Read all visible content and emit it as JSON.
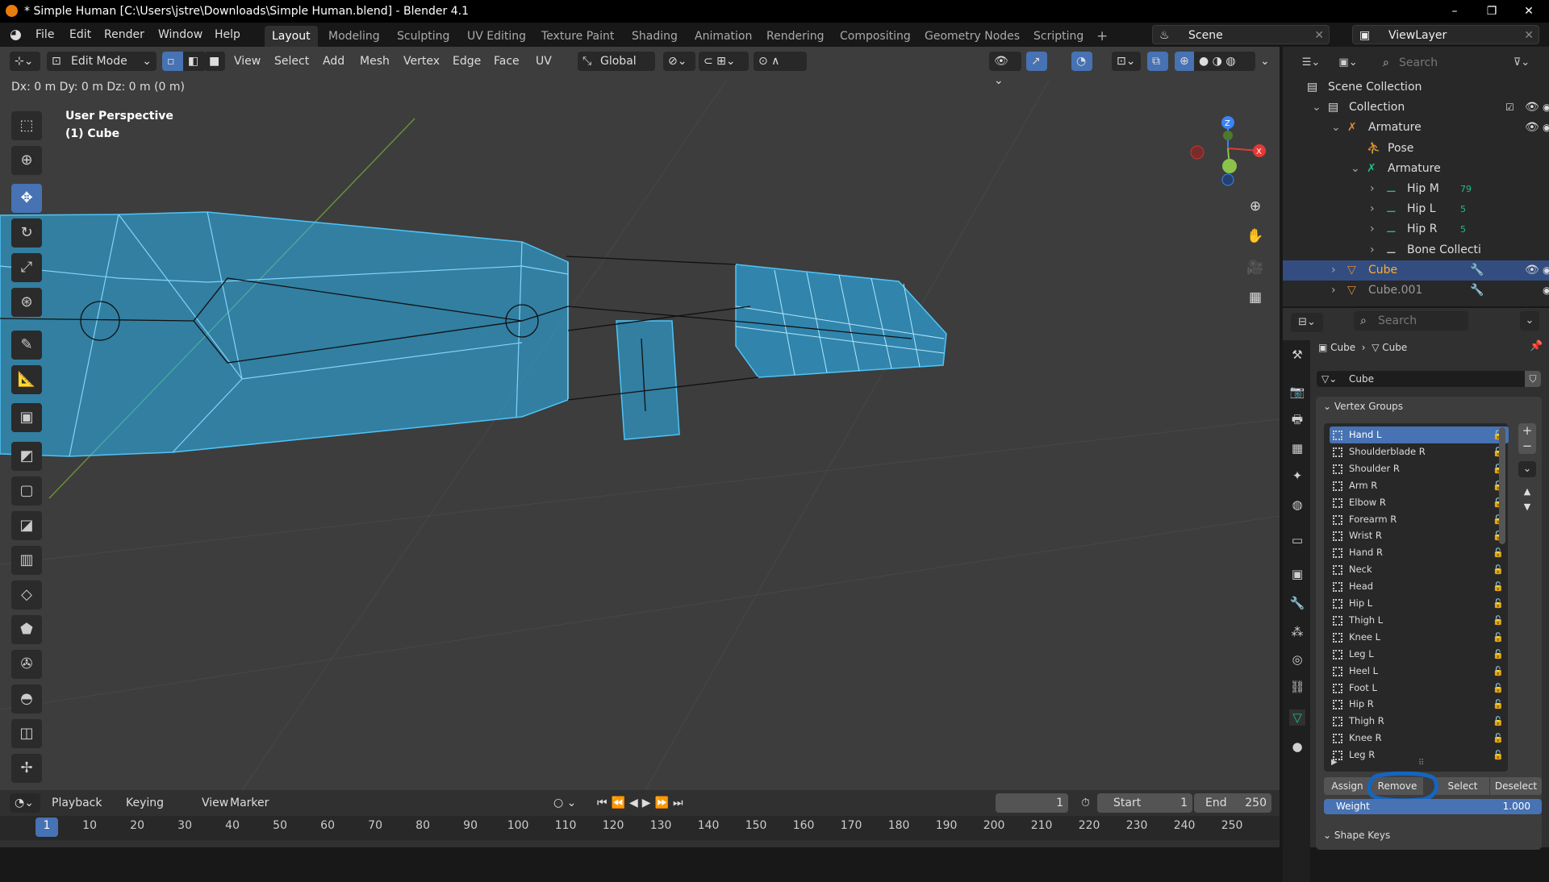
{
  "window": {
    "title": "* Simple Human [C:\\Users\\jstre\\Downloads\\Simple Human.blend] - Blender 4.1",
    "minimize": "–",
    "maximize": "❐",
    "close": "✕"
  },
  "menu": [
    "File",
    "Edit",
    "Render",
    "Window",
    "Help"
  ],
  "workspaces": [
    "Layout",
    "Modeling",
    "Sculpting",
    "UV Editing",
    "Texture Paint",
    "Shading",
    "Animation",
    "Rendering",
    "Compositing",
    "Geometry Nodes",
    "Scripting",
    "+"
  ],
  "scene": {
    "name": "Scene",
    "view_layer": "ViewLayer"
  },
  "viewport": {
    "mode": "Edit Mode",
    "menus": [
      "View",
      "Select",
      "Add",
      "Mesh",
      "Vertex",
      "Edge",
      "Face",
      "UV"
    ],
    "orientation": "Global",
    "status": "Dx: 0 m   Dy: 0 m   Dz: 0 m (0 m)",
    "perspective": "User Perspective",
    "object": "(1) Cube",
    "gizmo": {
      "x": "X",
      "y": "Y",
      "z": "Z"
    }
  },
  "tools": [
    "select-box",
    "cursor",
    "move",
    "rotate",
    "scale",
    "transform",
    "annotate",
    "measure",
    "add-cube",
    "extrude",
    "inset",
    "bevel",
    "loop-cut",
    "knife",
    "poly-build",
    "spin",
    "smooth",
    "shrink-fatten",
    "shear"
  ],
  "outliner": {
    "search_placeholder": "Search",
    "items": [
      {
        "label": "Scene Collection",
        "icon": "collection"
      },
      {
        "label": "Collection",
        "icon": "collection"
      },
      {
        "label": "Armature",
        "icon": "armature-object"
      },
      {
        "label": "Pose",
        "icon": "pose"
      },
      {
        "label": "Armature",
        "icon": "armature-data"
      },
      {
        "label": "Hip M",
        "icon": "bone",
        "badge": "79"
      },
      {
        "label": "Hip L",
        "icon": "bone",
        "badge": "5"
      },
      {
        "label": "Hip R",
        "icon": "bone",
        "badge": "5"
      },
      {
        "label": "Bone Collecti",
        "icon": "bone-collection"
      },
      {
        "label": "Cube",
        "icon": "mesh",
        "selected": true
      },
      {
        "label": "Cube.001",
        "icon": "mesh"
      }
    ]
  },
  "properties": {
    "search_placeholder": "Search",
    "breadcrumb": [
      "Cube",
      "Cube"
    ],
    "mesh_name": "Cube",
    "vertex_groups_title": "Vertex Groups",
    "vertex_groups": [
      "Hand L",
      "Shoulderblade R",
      "Shoulder R",
      "Arm R",
      "Elbow R",
      "Forearm R",
      "Wrist R",
      "Hand R",
      "Neck",
      "Head",
      "Hip L",
      "Thigh L",
      "Knee L",
      "Leg L",
      "Heel L",
      "Foot L",
      "Hip R",
      "Thigh R",
      "Knee R",
      "Leg R"
    ],
    "active_group": "Hand L",
    "buttons": [
      "Assign",
      "Remove",
      "Select",
      "Deselect"
    ],
    "weight_label": "Weight",
    "weight_value": "1.000",
    "shape_keys_title": "Shape Keys"
  },
  "timeline": {
    "menus": [
      "Playback",
      "Keying",
      "View",
      "Marker"
    ],
    "current_frame": "1",
    "start_label": "Start",
    "start": "1",
    "end_label": "End",
    "end": "250",
    "ticks": [
      "1",
      "10",
      "20",
      "30",
      "40",
      "50",
      "60",
      "70",
      "80",
      "90",
      "100",
      "110",
      "120",
      "130",
      "140",
      "150",
      "160",
      "170",
      "180",
      "190",
      "200",
      "210",
      "220",
      "230",
      "240",
      "250"
    ]
  },
  "colors": {
    "accent": "#4772b3",
    "mesh": "#29b6f6",
    "annotation": "#1565c0"
  }
}
